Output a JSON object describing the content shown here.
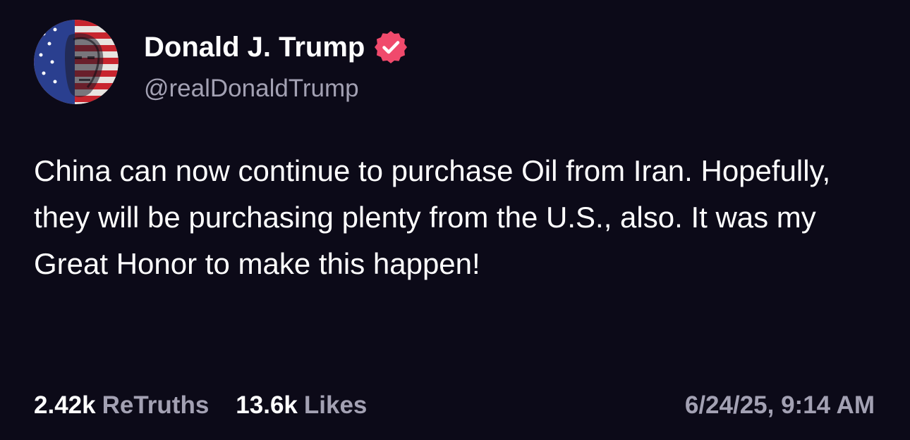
{
  "author": {
    "display_name": "Donald J. Trump",
    "handle": "@realDonaldTrump",
    "avatar_icon": "flag-portrait-avatar",
    "verified_icon": "verified-badge-icon",
    "verified_color": "#f04a6c"
  },
  "post": {
    "text": "China can now continue to purchase Oil from Iran. Hopefully, they will be purchasing plenty from the U.S., also. It was my Great Honor to make this happen!"
  },
  "stats": {
    "retruths_count": "2.42k",
    "retruths_label": "ReTruths",
    "likes_count": "13.6k",
    "likes_label": "Likes"
  },
  "timestamp": "6/24/25, 9:14 AM",
  "colors": {
    "background": "#0c0a18",
    "primary_text": "#ffffff",
    "secondary_text": "#a3a1b3"
  }
}
